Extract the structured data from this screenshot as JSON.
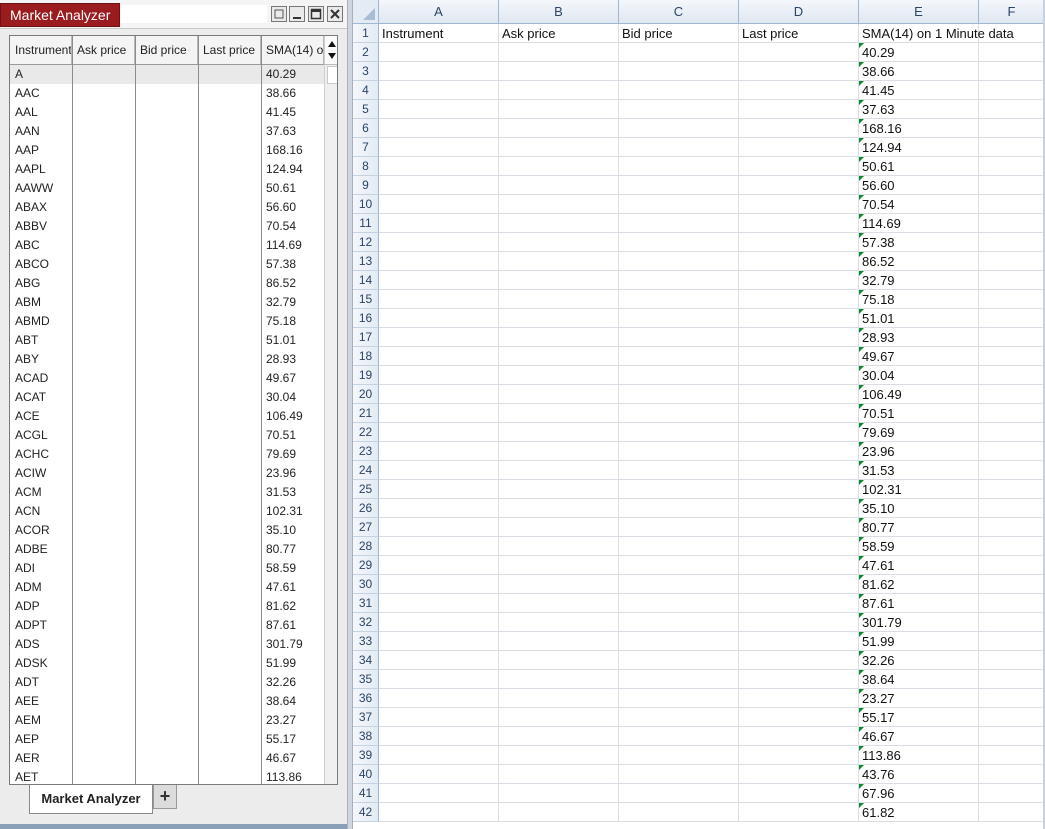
{
  "market_analyzer": {
    "title": "Market Analyzer",
    "columns": [
      "Instrument",
      "Ask price",
      "Bid price",
      "Last price",
      "SMA(14) on 1 Minute data"
    ],
    "rows": [
      {
        "instrument": "A",
        "sma": "40.29"
      },
      {
        "instrument": "AAC",
        "sma": "38.66"
      },
      {
        "instrument": "AAL",
        "sma": "41.45"
      },
      {
        "instrument": "AAN",
        "sma": "37.63"
      },
      {
        "instrument": "AAP",
        "sma": "168.16"
      },
      {
        "instrument": "AAPL",
        "sma": "124.94"
      },
      {
        "instrument": "AAWW",
        "sma": "50.61"
      },
      {
        "instrument": "ABAX",
        "sma": "56.60"
      },
      {
        "instrument": "ABBV",
        "sma": "70.54"
      },
      {
        "instrument": "ABC",
        "sma": "114.69"
      },
      {
        "instrument": "ABCO",
        "sma": "57.38"
      },
      {
        "instrument": "ABG",
        "sma": "86.52"
      },
      {
        "instrument": "ABM",
        "sma": "32.79"
      },
      {
        "instrument": "ABMD",
        "sma": "75.18"
      },
      {
        "instrument": "ABT",
        "sma": "51.01"
      },
      {
        "instrument": "ABY",
        "sma": "28.93"
      },
      {
        "instrument": "ACAD",
        "sma": "49.67"
      },
      {
        "instrument": "ACAT",
        "sma": "30.04"
      },
      {
        "instrument": "ACE",
        "sma": "106.49"
      },
      {
        "instrument": "ACGL",
        "sma": "70.51"
      },
      {
        "instrument": "ACHC",
        "sma": "79.69"
      },
      {
        "instrument": "ACIW",
        "sma": "23.96"
      },
      {
        "instrument": "ACM",
        "sma": "31.53"
      },
      {
        "instrument": "ACN",
        "sma": "102.31"
      },
      {
        "instrument": "ACOR",
        "sma": "35.10"
      },
      {
        "instrument": "ADBE",
        "sma": "80.77"
      },
      {
        "instrument": "ADI",
        "sma": "58.59"
      },
      {
        "instrument": "ADM",
        "sma": "47.61"
      },
      {
        "instrument": "ADP",
        "sma": "81.62"
      },
      {
        "instrument": "ADPT",
        "sma": "87.61"
      },
      {
        "instrument": "ADS",
        "sma": "301.79"
      },
      {
        "instrument": "ADSK",
        "sma": "51.99"
      },
      {
        "instrument": "ADT",
        "sma": "32.26"
      },
      {
        "instrument": "AEE",
        "sma": "38.64"
      },
      {
        "instrument": "AEM",
        "sma": "23.27"
      },
      {
        "instrument": "AEP",
        "sma": "55.17"
      },
      {
        "instrument": "AER",
        "sma": "46.67"
      },
      {
        "instrument": "AET",
        "sma": "113.86"
      }
    ],
    "tab_label": "Market Analyzer",
    "add_tab_label": "+"
  },
  "spreadsheet": {
    "column_letters": [
      "A",
      "B",
      "C",
      "D",
      "E",
      "F"
    ],
    "header_row": {
      "number": "1",
      "cells": [
        "Instrument",
        "Ask price",
        "Bid price",
        "Last price",
        "SMA(14) on 1 Minute data",
        ""
      ]
    },
    "e_values": [
      "40.29",
      "38.66",
      "41.45",
      "37.63",
      "168.16",
      "124.94",
      "50.61",
      "56.60",
      "70.54",
      "114.69",
      "57.38",
      "86.52",
      "32.79",
      "75.18",
      "51.01",
      "28.93",
      "49.67",
      "30.04",
      "106.49",
      "70.51",
      "79.69",
      "23.96",
      "31.53",
      "102.31",
      "35.10",
      "80.77",
      "58.59",
      "47.61",
      "81.62",
      "87.61",
      "301.79",
      "51.99",
      "32.26",
      "38.64",
      "23.27",
      "55.17",
      "46.67",
      "113.86",
      "43.76",
      "67.96",
      "61.82"
    ],
    "first_data_row": 2
  },
  "colors": {
    "title_red": "#9b1c1f",
    "excel_header_blue": "#2c4464",
    "green_indicator": "#0a8a2a"
  }
}
